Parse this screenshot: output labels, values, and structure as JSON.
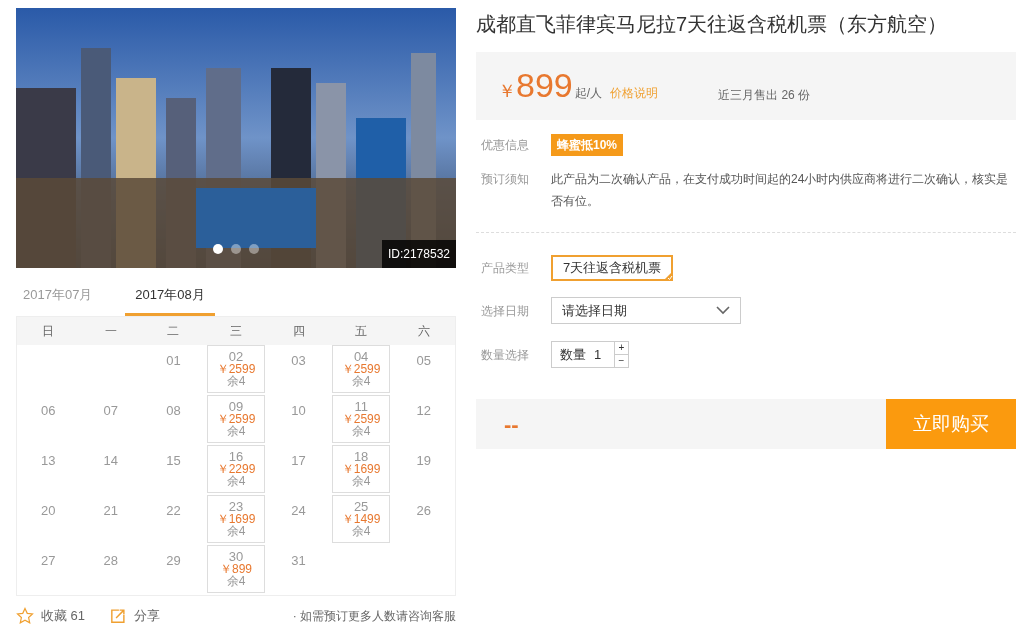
{
  "gallery": {
    "badge": "ID:2178532",
    "dots": [
      {
        "selected": true
      },
      {
        "selected": false
      },
      {
        "selected": false
      }
    ]
  },
  "month_tabs": [
    {
      "label": "2017年07月",
      "selected": false
    },
    {
      "label": "2017年08月",
      "selected": true
    }
  ],
  "weekdays": [
    "日",
    "一",
    "二",
    "三",
    "四",
    "五",
    "六"
  ],
  "calendar": [
    [
      {
        "kind": "blank"
      },
      {
        "kind": "blank"
      },
      {
        "kind": "day",
        "day": "01"
      },
      {
        "kind": "offer",
        "day": "02",
        "price": "￥2599",
        "stock": "余4"
      },
      {
        "kind": "day",
        "day": "03"
      },
      {
        "kind": "offer",
        "day": "04",
        "price": "￥2599",
        "stock": "余4"
      },
      {
        "kind": "day",
        "day": "05"
      }
    ],
    [
      {
        "kind": "day",
        "day": "06"
      },
      {
        "kind": "day",
        "day": "07"
      },
      {
        "kind": "day",
        "day": "08"
      },
      {
        "kind": "offer",
        "day": "09",
        "price": "￥2599",
        "stock": "余4"
      },
      {
        "kind": "day",
        "day": "10"
      },
      {
        "kind": "offer",
        "day": "11",
        "price": "￥2599",
        "stock": "余4"
      },
      {
        "kind": "day",
        "day": "12"
      }
    ],
    [
      {
        "kind": "day",
        "day": "13"
      },
      {
        "kind": "day",
        "day": "14"
      },
      {
        "kind": "day",
        "day": "15"
      },
      {
        "kind": "offer",
        "day": "16",
        "price": "￥2299",
        "stock": "余4"
      },
      {
        "kind": "day",
        "day": "17"
      },
      {
        "kind": "offer",
        "day": "18",
        "price": "￥1699",
        "stock": "余4"
      },
      {
        "kind": "day",
        "day": "19"
      }
    ],
    [
      {
        "kind": "day",
        "day": "20"
      },
      {
        "kind": "day",
        "day": "21"
      },
      {
        "kind": "day",
        "day": "22"
      },
      {
        "kind": "offer",
        "day": "23",
        "price": "￥1699",
        "stock": "余4"
      },
      {
        "kind": "day",
        "day": "24"
      },
      {
        "kind": "offer",
        "day": "25",
        "price": "￥1499",
        "stock": "余4"
      },
      {
        "kind": "day",
        "day": "26"
      }
    ],
    [
      {
        "kind": "day",
        "day": "27"
      },
      {
        "kind": "day",
        "day": "28"
      },
      {
        "kind": "day",
        "day": "29"
      },
      {
        "kind": "offer",
        "day": "30",
        "price": "￥899",
        "stock": "余4"
      },
      {
        "kind": "day",
        "day": "31"
      },
      {
        "kind": "blank"
      },
      {
        "kind": "blank"
      }
    ]
  ],
  "footer": {
    "favorite": "收藏 61",
    "share": "分享",
    "note": "· 如需预订更多人数请咨询客服"
  },
  "title": "成都直飞菲律宾马尼拉7天往返含税机票（东方航空）",
  "price": {
    "currency": "￥",
    "amount": "899",
    "unit": "起/人",
    "link": "价格说明",
    "sold": "近三月售出 26 份"
  },
  "promo": {
    "label": "优惠信息",
    "tag": "蜂蜜抵10%"
  },
  "notice": {
    "label": "预订须知",
    "text": "此产品为二次确认产品，在支付成功时间起的24小时内供应商将进行二次确认，核实是否有位。"
  },
  "product_type": {
    "label": "产品类型",
    "options": [
      {
        "label": "7天往返含税机票",
        "selected": true
      }
    ]
  },
  "date": {
    "label": "选择日期",
    "placeholder": "请选择日期"
  },
  "quantity": {
    "label": "数量选择",
    "prefix": "数量",
    "value": "1",
    "plus": "+",
    "minus": "−"
  },
  "total": "--",
  "buy_button": "立即购买"
}
